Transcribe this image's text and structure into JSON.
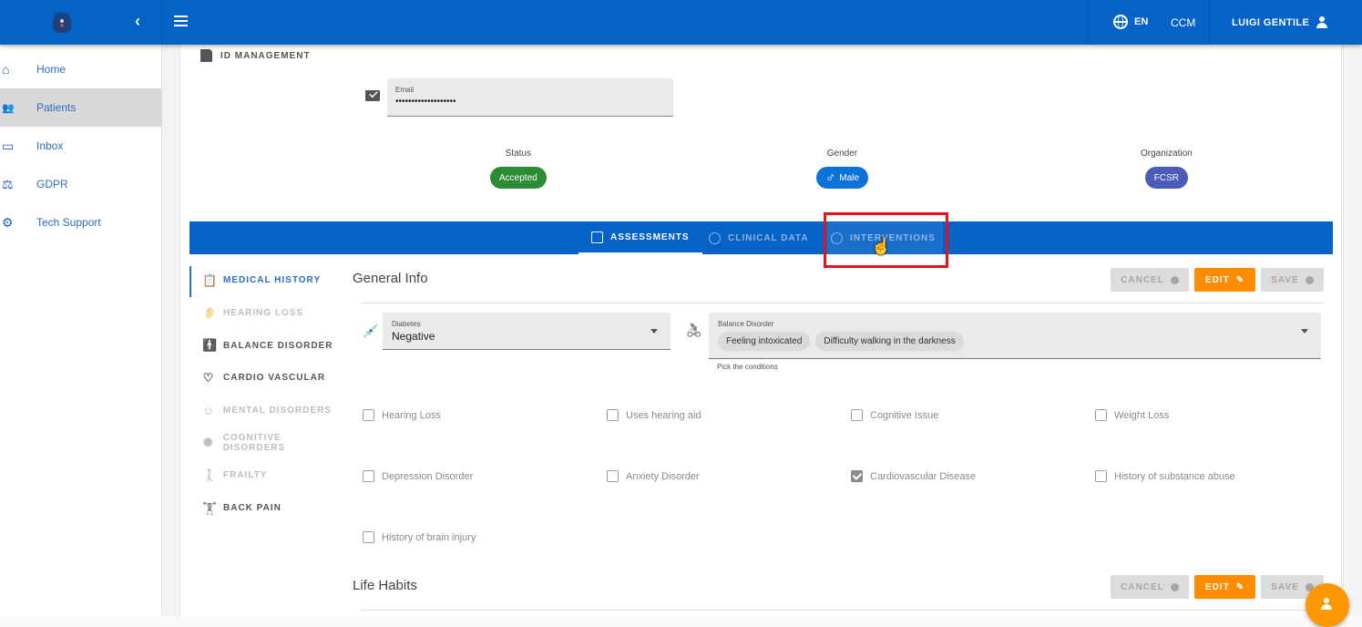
{
  "topbar": {
    "collapse_icon": "chevron-left",
    "menu_icon": "hamburger",
    "language": "EN",
    "org_code": "CCM",
    "user_name": "LUIGI GENTILE"
  },
  "sidebar": {
    "items": [
      {
        "label": "Home",
        "icon": "⌂",
        "active": false
      },
      {
        "label": "Patients",
        "icon": "👥",
        "active": true
      },
      {
        "label": "Inbox",
        "icon": "▭",
        "active": false
      },
      {
        "label": "GDPR",
        "icon": "⚖",
        "active": false
      },
      {
        "label": "Tech Support",
        "icon": "⚙",
        "active": false
      }
    ]
  },
  "patient": {
    "section_label": "ID MANAGEMENT",
    "email": {
      "label": "Email",
      "value": "•••••••••••••••••••"
    },
    "status": {
      "label": "Status",
      "value": "Accepted",
      "color": "#2e8b35"
    },
    "gender": {
      "label": "Gender",
      "value": "Male",
      "symbol": "♂",
      "color": "#0a72d8"
    },
    "organization": {
      "label": "Organization",
      "value": "FCSR",
      "color": "#4a5bb8"
    }
  },
  "tabs": [
    {
      "label": "ASSESSMENTS",
      "state": "active"
    },
    {
      "label": "CLINICAL DATA",
      "state": "inactive"
    },
    {
      "label": "INTERVENTIONS",
      "state": "hover"
    }
  ],
  "subnav": [
    {
      "label": "MEDICAL HISTORY",
      "icon": "📋",
      "state": "active"
    },
    {
      "label": "HEARING LOSS",
      "icon": "👂",
      "state": "disabled"
    },
    {
      "label": "BALANCE DISORDER",
      "icon": "🚹",
      "state": "normal"
    },
    {
      "label": "CARDIO VASCULAR",
      "icon": "♡",
      "state": "normal"
    },
    {
      "label": "MENTAL DISORDERS",
      "icon": "☺",
      "state": "disabled"
    },
    {
      "label": "COGNITIVE DISORDERS",
      "icon": "✺",
      "state": "disabled"
    },
    {
      "label": "FRAILTY",
      "icon": "🚶",
      "state": "disabled"
    },
    {
      "label": "BACK PAIN",
      "icon": "🏋",
      "state": "normal"
    }
  ],
  "general_info": {
    "title": "General Info",
    "buttons": {
      "cancel": "CANCEL",
      "edit": "EDIT",
      "save": "SAVE"
    },
    "diabetes": {
      "label": "Diabetes",
      "value": "Negative"
    },
    "balance_disorder": {
      "label": "Balance Disorder",
      "chips": [
        "Feeling intoxicated",
        "Difficulty walking in the darkness"
      ],
      "helper": "Pick the conditions"
    },
    "checkboxes": [
      {
        "label": "Hearing Loss",
        "checked": false
      },
      {
        "label": "Uses hearing aid",
        "checked": false
      },
      {
        "label": "Cognitive Issue",
        "checked": false
      },
      {
        "label": "Weight Loss",
        "checked": false
      },
      {
        "label": "Depression Disorder",
        "checked": false
      },
      {
        "label": "Anxiety Disorder",
        "checked": false
      },
      {
        "label": "Cardiovascular Disease",
        "checked": true
      },
      {
        "label": "History of substance abuse",
        "checked": false
      },
      {
        "label": "History of brain injury",
        "checked": false
      }
    ]
  },
  "life_habits": {
    "title": "Life Habits",
    "buttons": {
      "cancel": "CANCEL",
      "edit": "EDIT",
      "save": "SAVE"
    }
  },
  "colors": {
    "primary": "#0563c8",
    "accent": "#ff8c00",
    "highlight": "#e0151c"
  }
}
